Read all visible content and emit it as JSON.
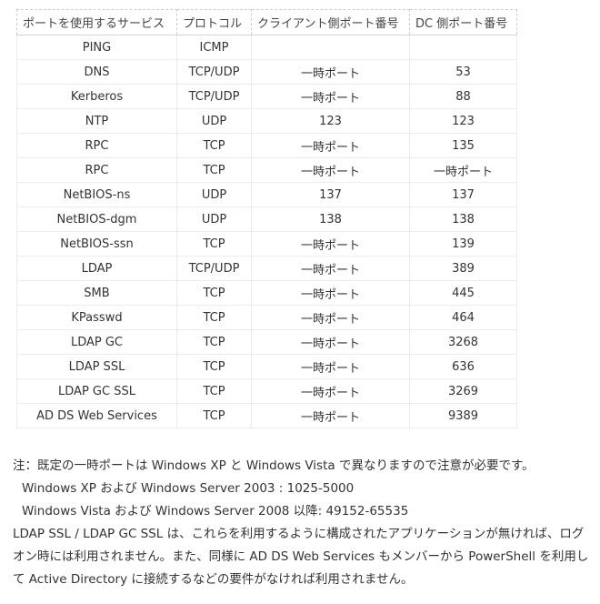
{
  "table": {
    "headers": [
      "ポートを使用するサービス",
      "プロトコル",
      "クライアント側ポート番号",
      "DC 側ポート番号"
    ],
    "rows": [
      {
        "service": "PING",
        "protocol": "ICMP",
        "client_port": "",
        "dc_port": ""
      },
      {
        "service": "DNS",
        "protocol": "TCP/UDP",
        "client_port": "一時ポート",
        "dc_port": "53"
      },
      {
        "service": "Kerberos",
        "protocol": "TCP/UDP",
        "client_port": "一時ポート",
        "dc_port": "88"
      },
      {
        "service": "NTP",
        "protocol": "UDP",
        "client_port": "123",
        "dc_port": "123"
      },
      {
        "service": "RPC",
        "protocol": "TCP",
        "client_port": "一時ポート",
        "dc_port": "135"
      },
      {
        "service": "RPC",
        "protocol": "TCP",
        "client_port": "一時ポート",
        "dc_port": "一時ポート"
      },
      {
        "service": "NetBIOS-ns",
        "protocol": "UDP",
        "client_port": "137",
        "dc_port": "137"
      },
      {
        "service": "NetBIOS-dgm",
        "protocol": "UDP",
        "client_port": "138",
        "dc_port": "138"
      },
      {
        "service": "NetBIOS-ssn",
        "protocol": "TCP",
        "client_port": "一時ポート",
        "dc_port": "139"
      },
      {
        "service": "LDAP",
        "protocol": "TCP/UDP",
        "client_port": "一時ポート",
        "dc_port": "389"
      },
      {
        "service": "SMB",
        "protocol": "TCP",
        "client_port": "一時ポート",
        "dc_port": "445"
      },
      {
        "service": "KPasswd",
        "protocol": "TCP",
        "client_port": "一時ポート",
        "dc_port": "464"
      },
      {
        "service": "LDAP GC",
        "protocol": "TCP",
        "client_port": "一時ポート",
        "dc_port": "3268"
      },
      {
        "service": "LDAP SSL",
        "protocol": "TCP",
        "client_port": "一時ポート",
        "dc_port": "636"
      },
      {
        "service": "LDAP GC SSL",
        "protocol": "TCP",
        "client_port": "一時ポート",
        "dc_port": "3269"
      },
      {
        "service": "AD DS Web Services",
        "protocol": "TCP",
        "client_port": "一時ポート",
        "dc_port": "9389"
      }
    ]
  },
  "notes": {
    "line1": "注：既定の一時ポートは Windows XP と Windows Vista で異なりますので注意が必要です。",
    "line2": "Windows XP および Windows Server 2003 : 1025-5000",
    "line3": "Windows Vista および Windows Server 2008 以降: 49152-65535",
    "paragraph": "LDAP SSL / LDAP GC SSL は、これらを利用するように構成されたアプリケーションが無ければ、ログオン時には利用されません。また、同様に AD DS Web Services もメンバーから PowerShell を利用して Active Directory に接続するなどの要件がなければ利用されません。"
  }
}
